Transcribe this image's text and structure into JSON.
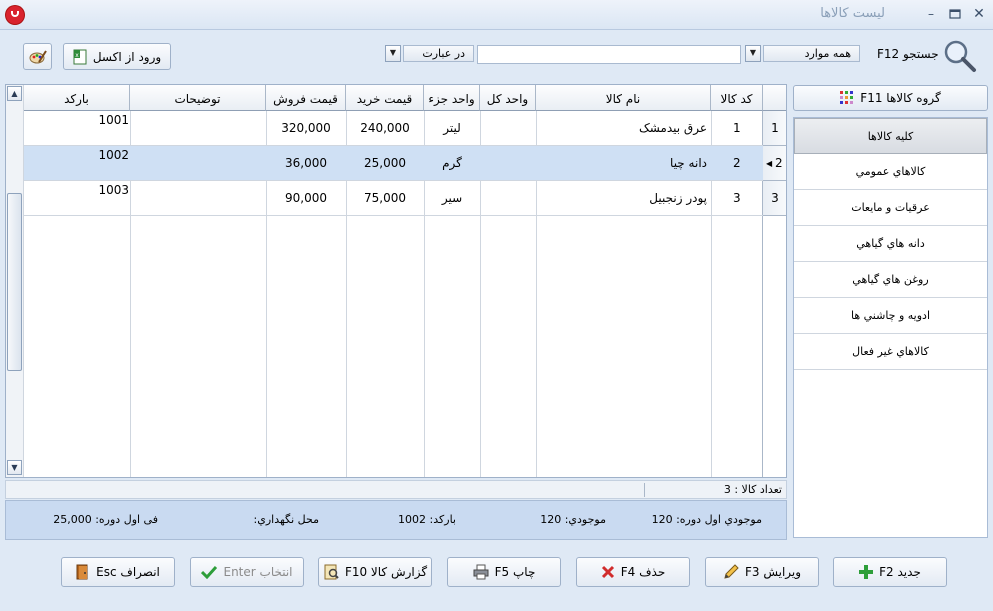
{
  "window": {
    "title": "لیست کالاها"
  },
  "toolbar": {
    "search_label": "جستجو F12",
    "scope_value": "همه موارد",
    "match_value": "در عبارت",
    "search_value": "",
    "excel_label": "ورود از اکسل"
  },
  "grid": {
    "columns": [
      "کد کالا",
      "نام کالا",
      "واحد کل",
      "واحد جزء",
      "قیمت خرید",
      "قیمت فروش",
      "توضیحات",
      "بارکد"
    ],
    "rows": [
      {
        "num": "1",
        "code": "1",
        "name": "عرق بیدمشک",
        "unit_all": "",
        "unit_part": "لیتر",
        "buy": "240,000",
        "sell": "320,000",
        "desc": "",
        "barcode": "1001"
      },
      {
        "num": "2",
        "code": "2",
        "name": "دانه چیا",
        "unit_all": "",
        "unit_part": "گرم",
        "buy": "25,000",
        "sell": "36,000",
        "desc": "",
        "barcode": "1002"
      },
      {
        "num": "3",
        "code": "3",
        "name": "پودر زنجبیل",
        "unit_all": "",
        "unit_part": "سیر",
        "buy": "75,000",
        "sell": "90,000",
        "desc": "",
        "barcode": "1003"
      }
    ],
    "selected_row": 2
  },
  "status": {
    "count_text": "تعداد کالا : 3"
  },
  "details": {
    "stock_start": "موجودي اول دوره: 120",
    "stock": "موجودي: 120",
    "barcode": "بارکد: 1002",
    "location": "محل نگهداري:",
    "price_start": "فی اول دوره: 25,000"
  },
  "groups": {
    "button_label": "گروه کالاها F11",
    "items": [
      "کلیه کالاها",
      "کالاهاي عمومي",
      "عرقیات و مایعات",
      "دانه هاي گیاهي",
      "روغن هاي گیاهي",
      "ادویه و چاشني ها",
      "کالاهاي غیر فعال"
    ],
    "active": 0
  },
  "actions": {
    "new": "جدید F2",
    "edit": "ویرایش F3",
    "delete": "حذف F4",
    "print": "چاپ F5",
    "report": "گزارش کالا F10",
    "select": "انتخاب Enter",
    "cancel": "انصراف Esc"
  },
  "colors": {
    "accent": "#cfe0f4",
    "panel": "#c9daf1",
    "background": "#dfe9f5",
    "close_red": "#d9232e"
  }
}
